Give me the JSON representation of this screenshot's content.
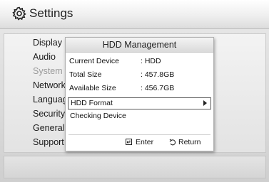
{
  "header": {
    "title": "Settings",
    "icon": "gear-icon"
  },
  "menu": {
    "items": [
      {
        "label": "Display",
        "dim": false
      },
      {
        "label": "Audio",
        "dim": false
      },
      {
        "label": "System",
        "dim": true
      },
      {
        "label": "Network",
        "dim": false
      },
      {
        "label": "Language",
        "dim": false
      },
      {
        "label": "Security",
        "dim": false
      },
      {
        "label": "General",
        "dim": false
      },
      {
        "label": "Support",
        "dim": false
      }
    ]
  },
  "dialog": {
    "title": "HDD Management",
    "rows": [
      {
        "label": "Current Device",
        "value": ": HDD"
      },
      {
        "label": "Total Size",
        "value": ": 457.8GB"
      },
      {
        "label": "Available Size",
        "value": ": 456.7GB"
      }
    ],
    "options": [
      {
        "label": "HDD Format",
        "selected": true
      },
      {
        "label": "Checking Device",
        "selected": false
      }
    ],
    "buttons": {
      "enter": {
        "label": "Enter",
        "icon": "enter-icon"
      },
      "return": {
        "label": "Return",
        "icon": "return-icon"
      }
    }
  },
  "colors": {
    "background": "#dcdcdc",
    "dialog_bg": "#ffffff",
    "text": "#1a1a1a",
    "dim_text": "#9a9a9a",
    "selection_border": "#5a5a5a"
  }
}
